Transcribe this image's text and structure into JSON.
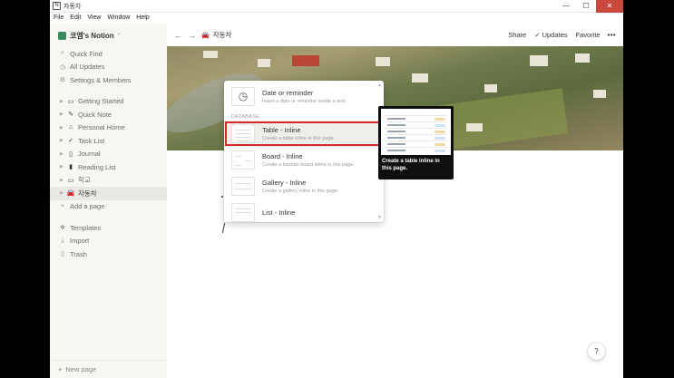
{
  "window": {
    "title": "자동차",
    "controls": {
      "minimize": "—",
      "maximize": "☐",
      "close": "✕"
    }
  },
  "menubar": [
    "File",
    "Edit",
    "View",
    "Window",
    "Help"
  ],
  "sidebar": {
    "workspace": "코엠's Notion",
    "actions": [
      {
        "icon": "search-icon",
        "glyph": "⌕",
        "label": "Quick Find"
      },
      {
        "icon": "clock-icon",
        "glyph": "◷",
        "label": "All Updates"
      },
      {
        "icon": "gear-icon",
        "glyph": "⚙",
        "label": "Settings & Members"
      }
    ],
    "pages": [
      {
        "glyph": "▭",
        "label": "Getting Started"
      },
      {
        "glyph": "✎",
        "label": "Quick Note"
      },
      {
        "glyph": "⌂",
        "label": "Personal Home"
      },
      {
        "glyph": "✓",
        "label": "Task List"
      },
      {
        "glyph": "▯",
        "label": "Journal"
      },
      {
        "glyph": "▮",
        "label": "Reading List"
      },
      {
        "glyph": "▭",
        "label": "학교"
      },
      {
        "glyph": "🚘",
        "label": "자동차"
      }
    ],
    "add_page": "Add a page",
    "templates": "Templates",
    "import": "Import",
    "trash": "Trash",
    "new_page": "New page"
  },
  "topbar": {
    "breadcrumb": "자동차",
    "share": "Share",
    "updates": "Updates",
    "favorite": "Favorite",
    "more": "•••"
  },
  "slash_menu": {
    "reminder": {
      "title": "Date or reminder",
      "desc": "Insert a date or reminder inside a text."
    },
    "section": "DATABASE",
    "items": [
      {
        "title": "Table - Inline",
        "desc": "Create a table inline in this page."
      },
      {
        "title": "Board - Inline",
        "desc": "Create a kanban board inline in this page."
      },
      {
        "title": "Gallery - Inline",
        "desc": "Create a gallery inline in this page."
      },
      {
        "title": "List - Inline",
        "desc": ""
      }
    ]
  },
  "preview": {
    "text": "Create a table inline in this page."
  },
  "help": "?"
}
